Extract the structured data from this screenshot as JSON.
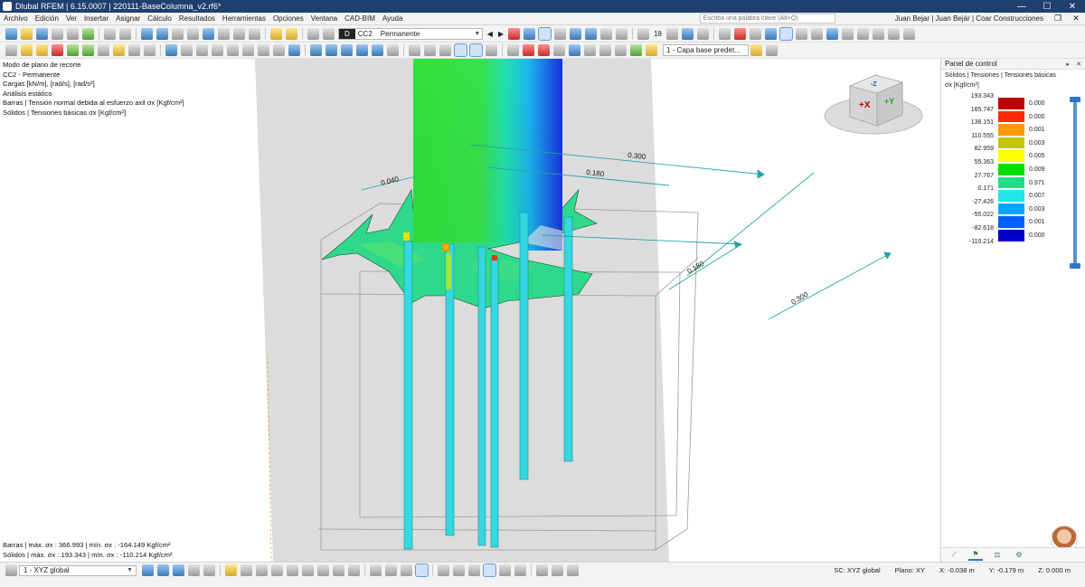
{
  "window": {
    "title": "Dlubal RFEM | 6.15.0007 | 220111-BaseColumna_v2.rf6*",
    "minimize": "—",
    "maximize": "☐",
    "close": "✕"
  },
  "menu": {
    "items": [
      "Archivo",
      "Edición",
      "Ver",
      "Insertar",
      "Asignar",
      "Cálculo",
      "Resultados",
      "Herramientas",
      "Opciones",
      "Ventana",
      "CAD-BIM",
      "Ayuda"
    ],
    "search_placeholder": "Escriba una palabra clave (Alt+Q)",
    "user": "Juan Bejar | Juan Bejár | Coar Construcciones"
  },
  "toolbar": {
    "load_case_id": "D",
    "load_case_code": "CC2",
    "load_case_name": "Permanente",
    "dim_label": "18",
    "layer": "1 - Capa base predet..."
  },
  "viewport": {
    "info_lines": [
      "Modo de plano de recorte",
      "CC2 - Permanente",
      "Cargas [kN/m], [rad/s], [rad/s²]",
      "Análisis estático",
      "Barras | Tensión normal debida al esfuerzo axil σx [Kgf/cm²]",
      "Sólidos | Tensiones básicas σx [Kgf/cm²]"
    ],
    "dimensions": {
      "d1": "0.300",
      "d2": "0.180",
      "d3": "0.040",
      "d4": "0.180",
      "d5": "0.300"
    },
    "nav_cube": {
      "face_x": "+X",
      "face_y": "+Y",
      "face_z": "-Z"
    },
    "bottom_lines": [
      "Barras | máx. σx : 366.993 | mín. σx : -164.149 Kgf/cm²",
      "Sólidos | máx. σx : 193.343 | mín. σx : -110.214 Kgf/cm²"
    ]
  },
  "panel": {
    "title": "Panel de control",
    "subtitle": "Sólidos | Tensiones | Tensiones básicas",
    "unit": "σx [Kgf/cm²]",
    "legend_values": [
      "193.343",
      "165.747",
      "138.151",
      "110.555",
      "82.959",
      "55.363",
      "27.767",
      "0.171",
      "-27.426",
      "-55.022",
      "-82.618",
      "-110.214"
    ],
    "legend_pcts": [
      "0.000",
      "0.000",
      "0.001",
      "0.003",
      "0.005",
      "0.009",
      "0.971",
      "0.007",
      "0.003",
      "0.001",
      "0.000"
    ],
    "legend_colors": [
      "#c00000",
      "#ff2a00",
      "#ff9a00",
      "#c6c600",
      "#ffff00",
      "#00e000",
      "#22dd88",
      "#22e6e6",
      "#00a8ff",
      "#0060ff",
      "#0000c8"
    ]
  },
  "statusbar": {
    "coordinate_system": "1 - XYZ global",
    "sc": "SC: XYZ global",
    "plane": "Plano: XY",
    "x": "X: -0.038 m",
    "y": "Y: -0.179 m",
    "z": "Z: 0.000 m"
  }
}
